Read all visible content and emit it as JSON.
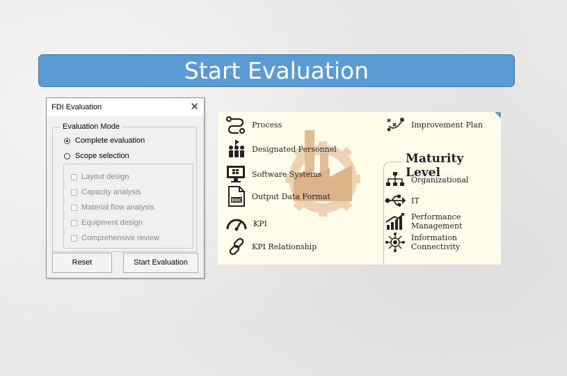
{
  "banner": {
    "title": "Start Evaluation"
  },
  "dialog": {
    "title": "FDI Evaluation",
    "close_symbol": "✕",
    "mode_group_label": "Evaluation Mode",
    "radios": [
      {
        "label": "Complete evaluation",
        "checked": true
      },
      {
        "label": "Scope selection",
        "checked": false
      }
    ],
    "scope_items": [
      {
        "label": "Layout design",
        "checked": false,
        "enabled": false
      },
      {
        "label": "Capacity analysis",
        "checked": false,
        "enabled": false
      },
      {
        "label": "Material flow analysis",
        "checked": false,
        "enabled": false
      },
      {
        "label": "Equipment design",
        "checked": false,
        "enabled": false
      },
      {
        "label": "Comprehensive review",
        "checked": false,
        "enabled": false
      }
    ],
    "buttons": {
      "reset": "Reset",
      "start": "Start Evaluation"
    }
  },
  "panel": {
    "left_items": [
      {
        "label": "Process",
        "icon": "process-icon"
      },
      {
        "label": "Designated Personnel",
        "icon": "personnel-icon"
      },
      {
        "label": "Software Systems",
        "icon": "monitor-icon"
      },
      {
        "label": "Output Data Format",
        "icon": "doc-icon"
      },
      {
        "label": "KPI",
        "icon": "gauge-icon"
      },
      {
        "label": "KPI Relationship",
        "icon": "link-icon"
      }
    ],
    "improvement_plan": {
      "label": "Improvement Plan",
      "icon": "improvement-icon"
    },
    "maturity_title": "Maturity Level",
    "maturity_items": [
      {
        "label": "Organizational",
        "icon": "org-chart-icon"
      },
      {
        "label": "IT",
        "icon": "usb-icon"
      },
      {
        "label": "Performance Management",
        "icon": "growth-chart-icon"
      },
      {
        "label": "Information Connectivity",
        "icon": "network-icon"
      }
    ]
  },
  "colors": {
    "banner": "#5b9bd5",
    "panel_bg": "#fffde9",
    "watermark": "#d9b28a"
  }
}
